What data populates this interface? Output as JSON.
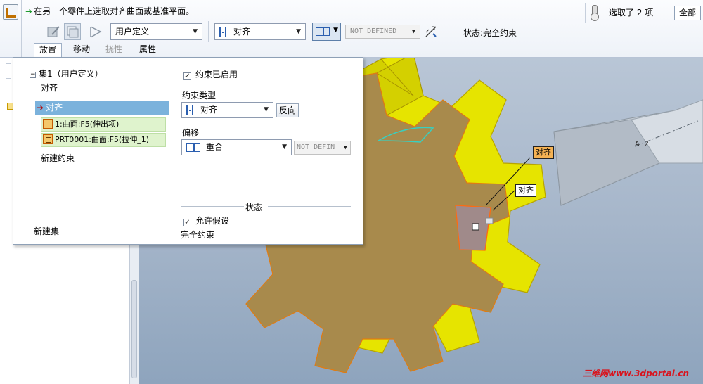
{
  "dashboard": {
    "prompt": "在另一个零件上选取对齐曲面或基准平面。",
    "selected_count": "选取了 2 项",
    "filter": "全部",
    "type_combo": "用户定义",
    "constraint_combo": "对齐",
    "offset_value": "NOT DEFINED",
    "status": "状态:完全约束",
    "tabs": [
      "放置",
      "移动",
      "挠性",
      "属性"
    ]
  },
  "panel": {
    "set_title": "集1（用户定义）",
    "constraint_items": [
      "对齐",
      "对齐"
    ],
    "references": [
      "1:曲面:F5(伸出项)",
      "PRT0001:曲面:F5(拉伸_1)"
    ],
    "new_constraint": "新建约束",
    "new_set": "新建集",
    "enabled_label": "约束已启用",
    "type_label": "约束类型",
    "type_value": "对齐",
    "flip_button": "反向",
    "offset_label": "偏移",
    "offset_value": "重合",
    "offset_disabled": "NOT DEFIN",
    "status_group": "状态",
    "allow_assumptions": "允许假设",
    "status_text": "完全约束"
  },
  "viewport": {
    "callout_1": "对齐",
    "callout_2": "对齐",
    "axis_label": "A_2",
    "watermark": "三维网www.3dportal.cn"
  },
  "colors": {
    "gear_face": "#a88a4c",
    "gear_side": "#e8e600",
    "selection_blue": "#7bb2dc",
    "reference_green": "#dff3cd"
  }
}
